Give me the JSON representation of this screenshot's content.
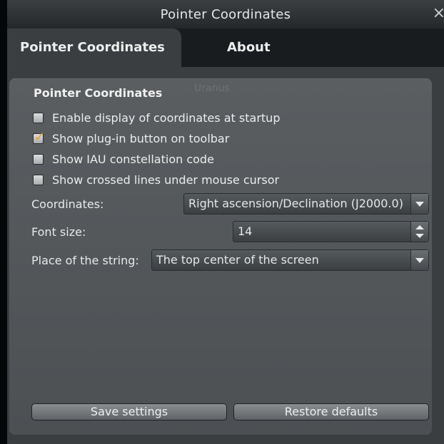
{
  "window": {
    "title": "Pointer Coordinates"
  },
  "tabs": [
    {
      "label": "Pointer Coordinates"
    },
    {
      "label": "About"
    }
  ],
  "background_object_label": "Uranus",
  "group": {
    "title": "Pointer Coordinates",
    "checkboxes": [
      {
        "label": "Enable display of coordinates at startup",
        "checked": false
      },
      {
        "label": "Show plug-in button on toolbar",
        "checked": true
      },
      {
        "label": "Show IAU constellation code",
        "checked": false
      },
      {
        "label": "Show crossed lines under mouse cursor",
        "checked": false
      }
    ],
    "coordinates": {
      "label": "Coordinates:",
      "value": "Right ascension/Declination (J2000.0)"
    },
    "font_size": {
      "label": "Font size:",
      "value": "14"
    },
    "place": {
      "label": "Place of the string:",
      "value": "The top center of the screen"
    }
  },
  "buttons": {
    "save": "Save settings",
    "restore": "Restore defaults"
  },
  "colors": {
    "accent_check": "#f0a020",
    "panel": "#4c5053",
    "background": "#050607"
  }
}
